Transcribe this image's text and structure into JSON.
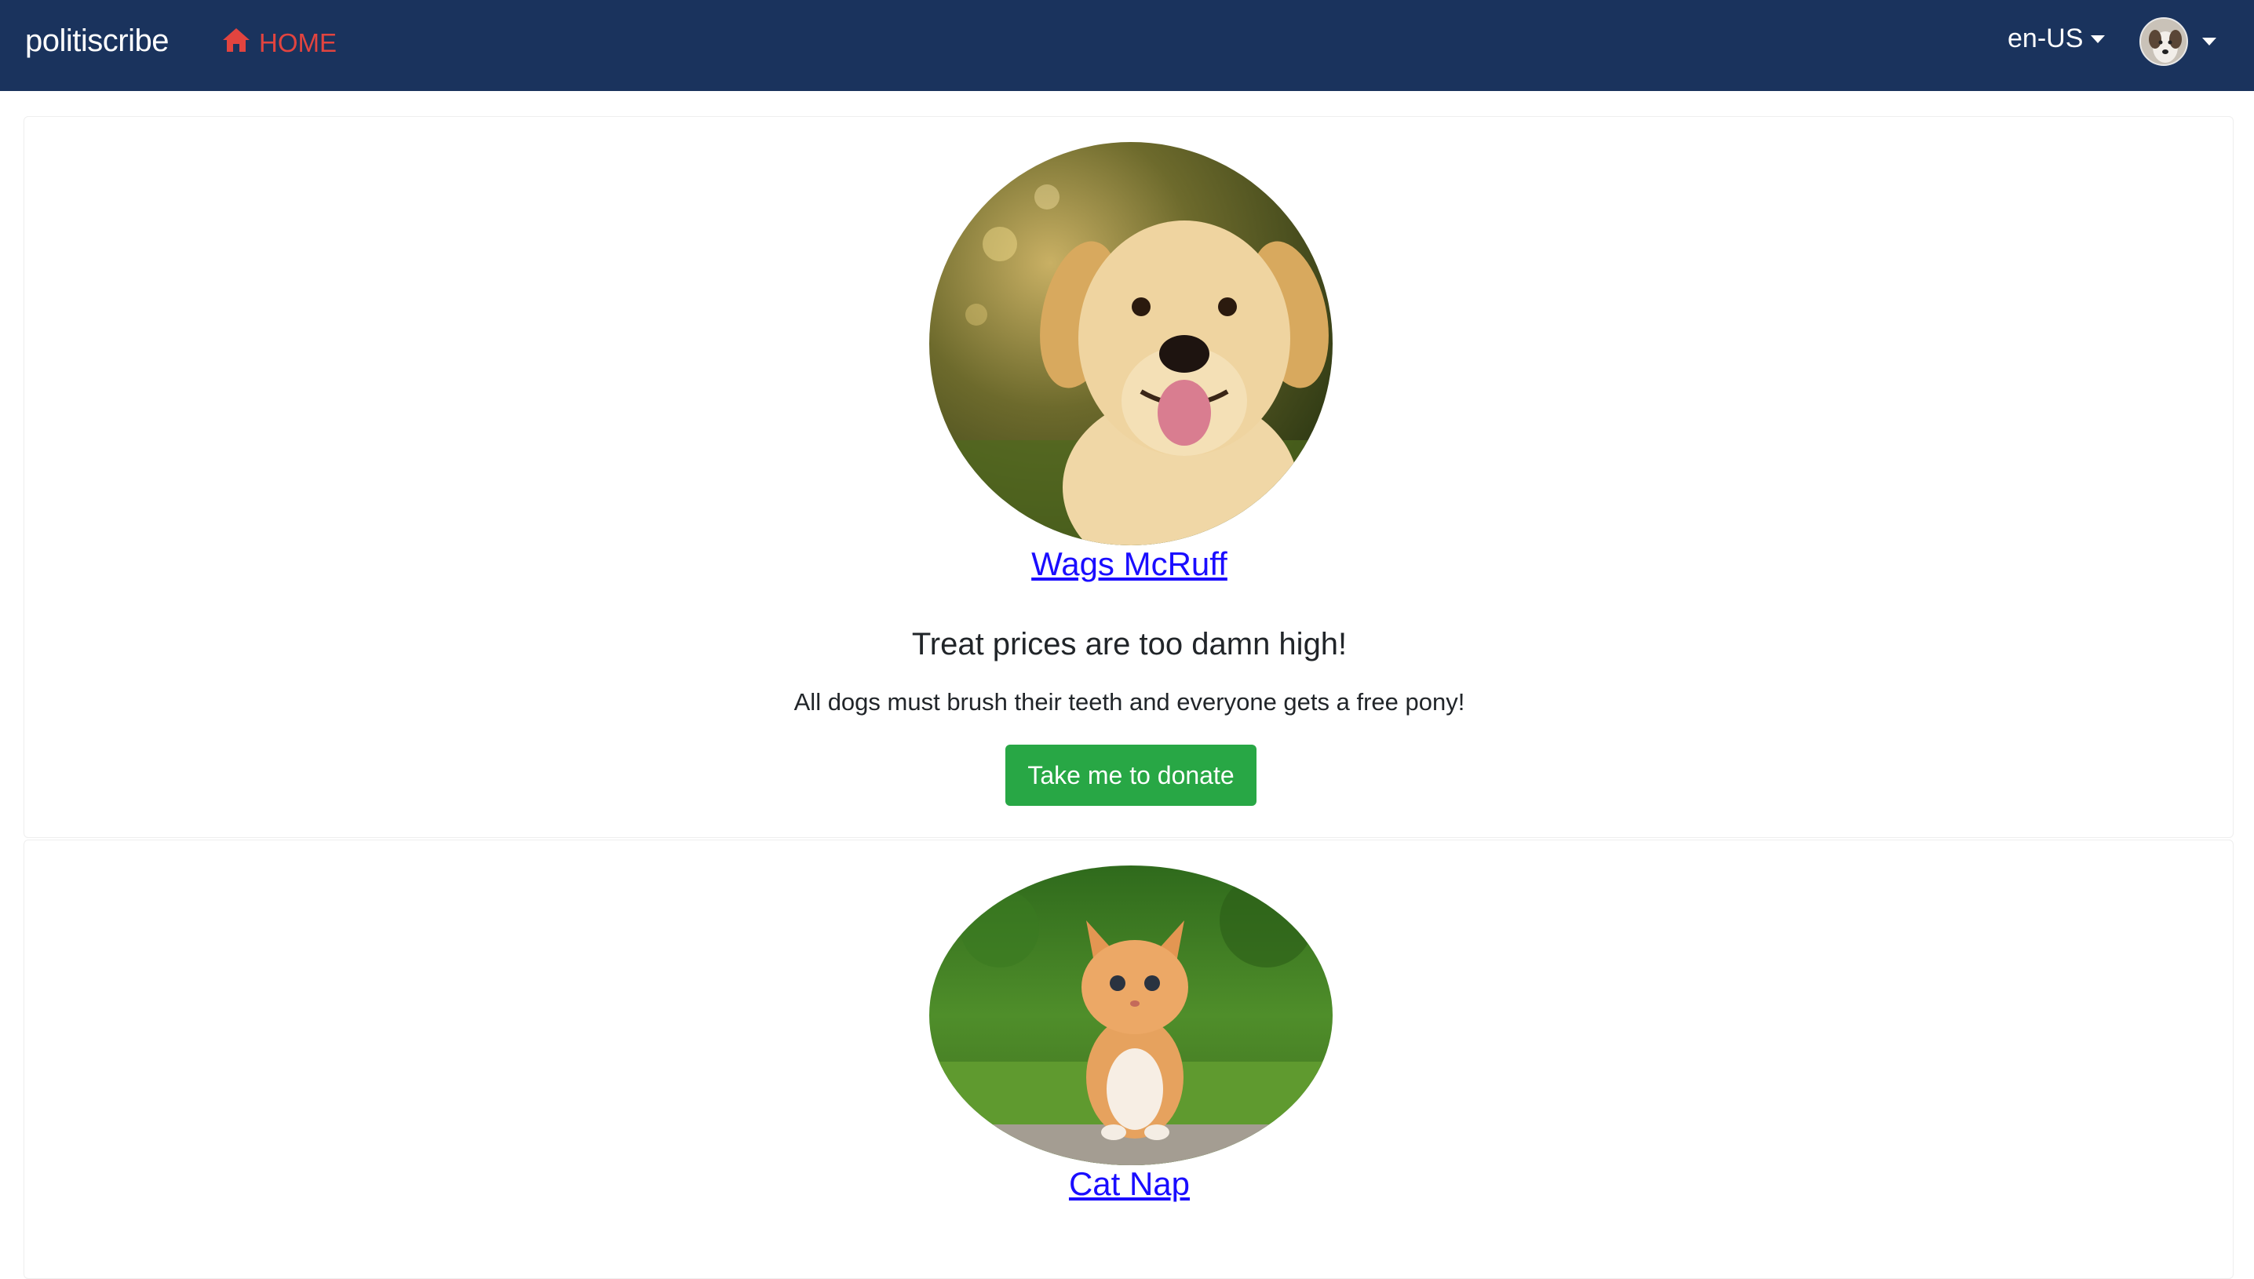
{
  "navbar": {
    "brand": "politiscribe",
    "home_label": "HOME",
    "home_icon": "home-icon",
    "language": "en-US",
    "user_avatar_icon": "user-avatar",
    "accent_color": "#e2443f",
    "background_color": "#1a335d"
  },
  "candidates": [
    {
      "name": "Wags McRuff",
      "photo": "golden-retriever-photo",
      "headline": "Treat prices are too damn high!",
      "description": "All dogs must brush their teeth and everyone gets a free pony!",
      "donate_label": "Take me to donate"
    },
    {
      "name": "Cat Nap",
      "photo": "orange-kitten-photo"
    }
  ],
  "button_color": "#28a745",
  "link_color": "#1a0dff"
}
